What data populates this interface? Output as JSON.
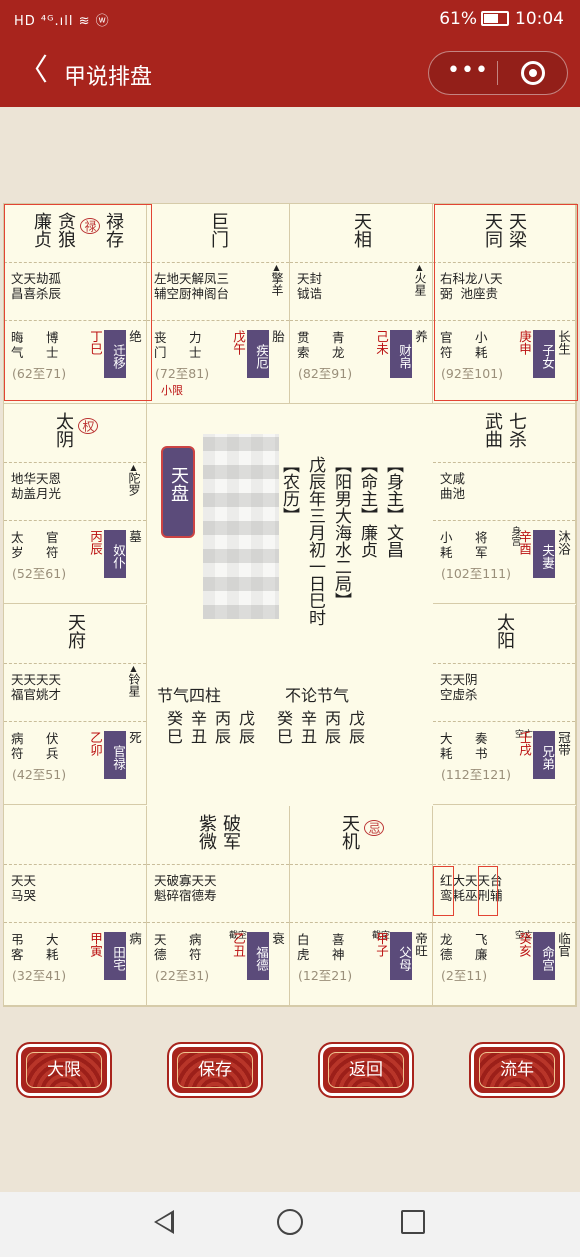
{
  "status": {
    "left": "HD ⁴ᴳ.ıll ≋ ⓦ",
    "battery": "61%",
    "time": "10:04"
  },
  "nav": {
    "title": "甲说排盘",
    "back": "〈",
    "more": "•••"
  },
  "cells": [
    {
      "id": "sisi",
      "stars": [
        "廉贞",
        "贪狼",
        "禄",
        "禄存"
      ],
      "minor": "文天劫孤\n昌喜杀辰",
      "right": "",
      "gods": "晦\n气",
      "gods2": "博\n士",
      "stem": "丁巳",
      "palace": "迁移",
      "stage": "绝",
      "age": "(62至71)"
    },
    {
      "id": "wu",
      "stars": [
        "巨门"
      ],
      "minor": "左地天解凤三\n辅空厨神阁台",
      "right": "擎羊",
      "gods": "丧\n门",
      "gods2": "力\n士",
      "stem": "戊午",
      "palace": "疾厄",
      "stage": "胎",
      "age": "(72至81)",
      "extra": "小限"
    },
    {
      "id": "wei",
      "stars": [
        "天相"
      ],
      "minor": "天封\n钺诰",
      "right": "火星",
      "gods": "贯\n索",
      "gods2": "青\n龙",
      "stem": "己未",
      "palace": "财帛",
      "stage": "养",
      "age": "(82至91)"
    },
    {
      "id": "shen",
      "stars": [
        "天同",
        "天梁"
      ],
      "minor": "右科龙八天\n弼  池座贵",
      "right": "",
      "gods": "官\n符",
      "gods2": "小\n耗",
      "stem": "庚申",
      "palace": "子女",
      "stage": "长生",
      "age": "(92至101)"
    },
    {
      "id": "chen",
      "stars": [
        "太阴",
        "权"
      ],
      "minor": "地华天恩\n劫盖月光",
      "right": "陀罗",
      "gods": "太\n岁",
      "gods2": "官\n符",
      "stem": "丙辰",
      "palace": "奴仆",
      "stage": "墓",
      "age": "(52至61)"
    },
    {
      "id": "you",
      "stars": [
        "武曲",
        "七杀"
      ],
      "minor": "文咸\n曲池",
      "right": "",
      "gods": "小\n耗",
      "gods2": "将\n军",
      "stem": "辛酉",
      "palace": "夫妻",
      "stage": "沐浴",
      "age": "(102至111)",
      "note": "身宫"
    },
    {
      "id": "mao",
      "stars": [
        "天府"
      ],
      "minor": "天天天天\n福官姚才",
      "right": "铃星",
      "gods": "病\n符",
      "gods2": "伏\n兵",
      "stem": "乙卯",
      "palace": "官禄",
      "stage": "死",
      "age": "(42至51)"
    },
    {
      "id": "xu",
      "stars": [
        "太阳"
      ],
      "minor": "天天阴\n空虚杀",
      "right": "",
      "gods": "大\n耗",
      "gods2": "奏\n书",
      "stem": "壬戌",
      "palace": "兄弟",
      "stage": "冠带",
      "age": "(112至121)",
      "note": "空亡"
    },
    {
      "id": "yin",
      "stars": [],
      "minor": "天天\n马哭",
      "right": "",
      "gods": "弔\n客",
      "gods2": "大\n耗",
      "stem": "甲寅",
      "palace": "田宅",
      "stage": "病",
      "age": "(32至41)"
    },
    {
      "id": "chou",
      "stars": [
        "紫微",
        "破军"
      ],
      "minor": "天破寡天天\n魁碎宿德寿",
      "right": "",
      "gods": "天\n德",
      "gods2": "病\n符",
      "stem": "乙丑",
      "palace": "福德",
      "stage": "衰",
      "age": "(22至31)",
      "note": "截空"
    },
    {
      "id": "zi",
      "stars": [
        "天机",
        "忌"
      ],
      "minor": "",
      "right": "",
      "gods": "白\n虎",
      "gods2": "喜\n神",
      "stem": "甲子",
      "palace": "父母",
      "stage": "帝旺",
      "age": "(12至21)",
      "note": "截空"
    },
    {
      "id": "hai",
      "stars": [],
      "minor": "红大天天台\n鸾耗巫刑辅",
      "right": "",
      "gods": "龙\n德",
      "gods2": "飞\n廉",
      "stem": "癸亥",
      "palace": "命宫",
      "stage": "临官",
      "age": "(2至11)",
      "note": "空亡"
    }
  ],
  "center": {
    "tianpan": "天盘",
    "col1": "【农历】",
    "col2": "戊辰年三月初一日巳时",
    "col3": "【阳男大海水二局】",
    "col4": "【命主】廉贞",
    "col5": "【身主】文昌",
    "jieqi_label": "节气四柱",
    "bulun_label": "不论节气",
    "pillars_top": [
      "癸",
      "辛",
      "丙",
      "戊",
      "癸",
      "辛",
      "丙",
      "戊"
    ],
    "pillars_bottom": [
      "巳",
      "丑",
      "辰",
      "辰",
      "巳",
      "丑",
      "辰",
      "辰"
    ]
  },
  "buttons": [
    "大限",
    "保存",
    "返回",
    "流年"
  ]
}
